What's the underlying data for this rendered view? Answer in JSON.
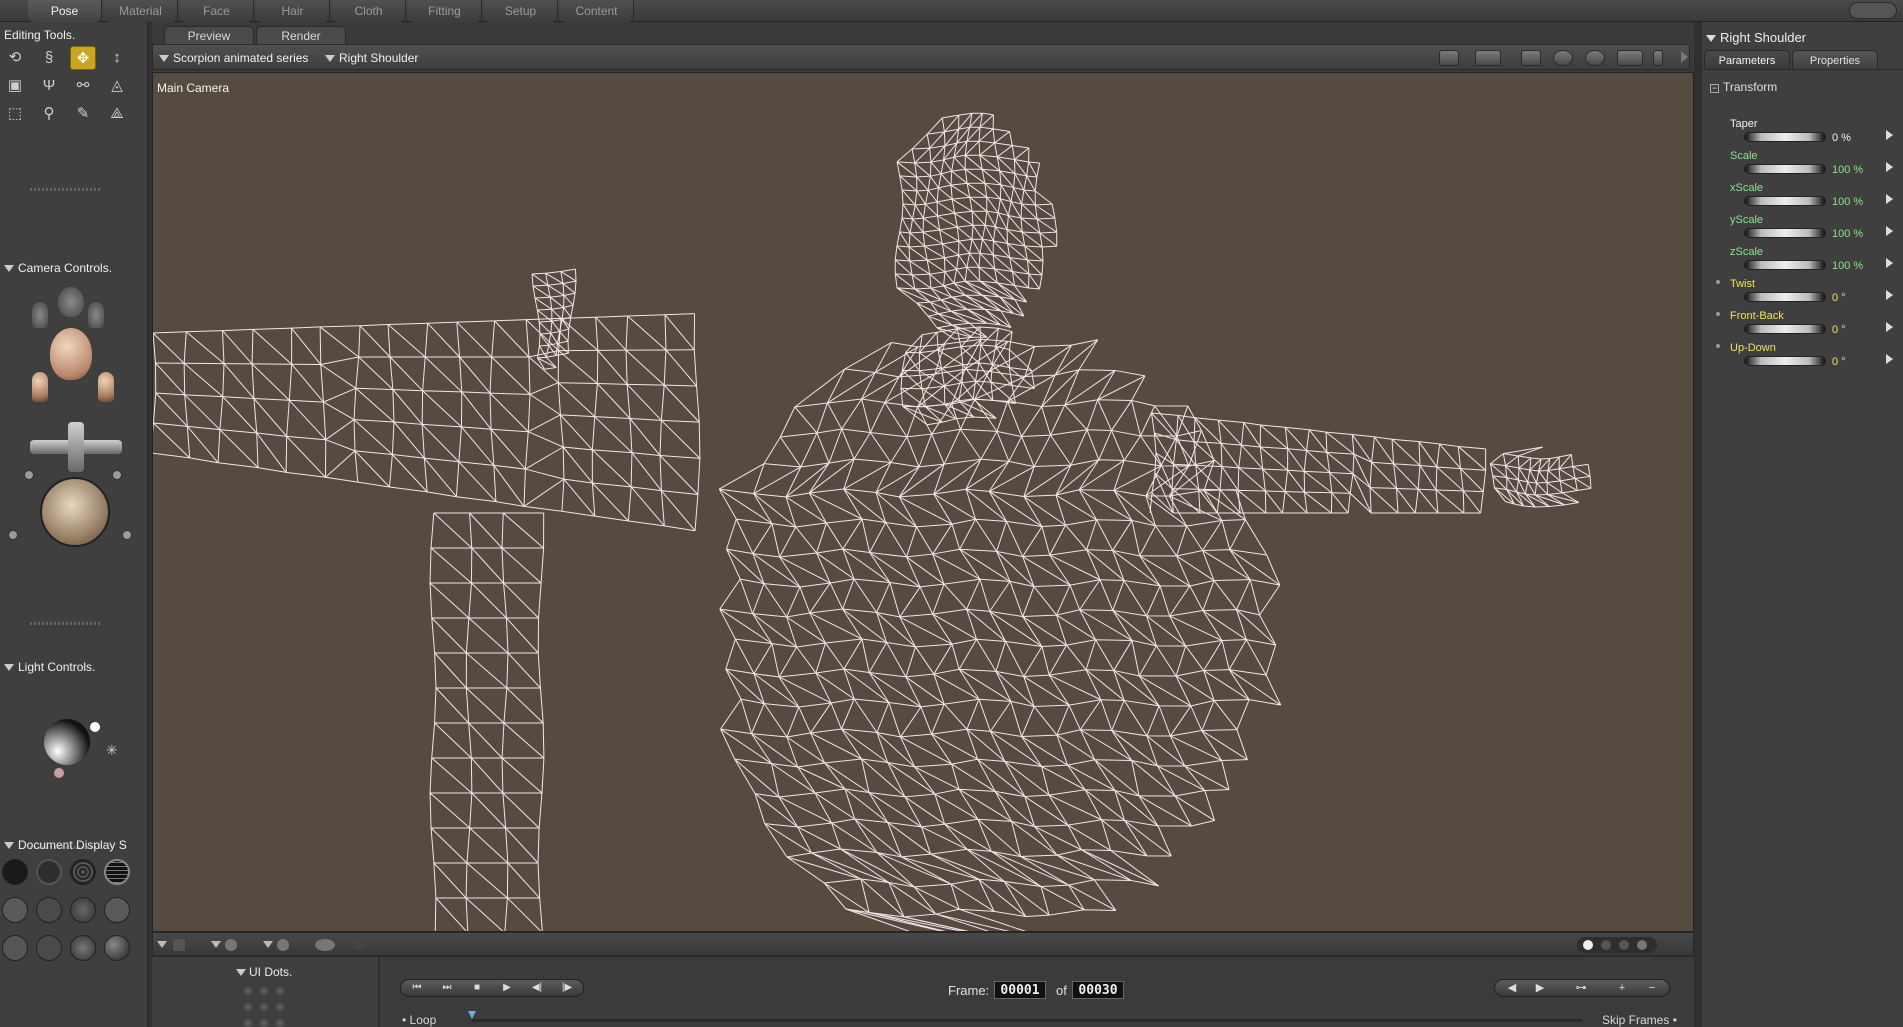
{
  "rooms": [
    "Pose",
    "Material",
    "Face",
    "Hair",
    "Cloth",
    "Fitting",
    "Setup",
    "Content"
  ],
  "active_room": "Pose",
  "left": {
    "editing_tools_title": "Editing Tools.",
    "camera_controls_title": "Camera Controls.",
    "light_controls_title": "Light Controls.",
    "document_display_title": "Document Display S"
  },
  "viewport": {
    "tabs": [
      "Preview",
      "Render"
    ],
    "figure_select": "Scorpion animated series",
    "actor_select": "Right Shoulder",
    "camera_label": "Main Camera"
  },
  "animation": {
    "ui_dots_title": "UI Dots.",
    "frame_label": "Frame:",
    "current_frame": "00001",
    "of_label": "of",
    "total_frames": "00030",
    "loop_label": "Loop",
    "skip_frames_label": "Skip Frames"
  },
  "right": {
    "title": "Right Shoulder",
    "tabs": [
      "Parameters",
      "Properties"
    ],
    "section": "Transform",
    "params": [
      {
        "name": "Taper",
        "value": "0 %",
        "color": "#f0f0f0"
      },
      {
        "name": "Scale",
        "value": "100 %",
        "color": "#8fe08f"
      },
      {
        "name": "xScale",
        "value": "100 %",
        "color": "#8fe08f"
      },
      {
        "name": "yScale",
        "value": "100 %",
        "color": "#8fe08f"
      },
      {
        "name": "zScale",
        "value": "100 %",
        "color": "#8fe08f"
      },
      {
        "name": "Twist",
        "value": "0 °",
        "color": "#f0e060"
      },
      {
        "name": "Front-Back",
        "value": "0 °",
        "color": "#f0e060"
      },
      {
        "name": "Up-Down",
        "value": "0 °",
        "color": "#f0e060"
      }
    ]
  },
  "colors": {
    "viewport_bg": "#564b40",
    "wireframe": "#f2e6ea",
    "active_tool": "#c9a520"
  }
}
